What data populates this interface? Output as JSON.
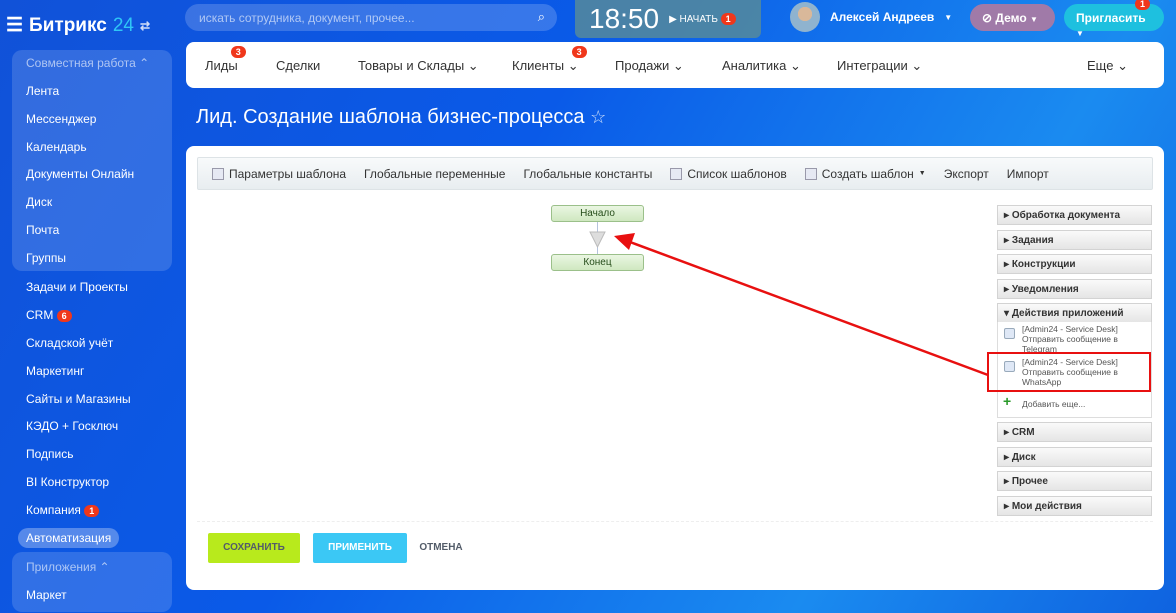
{
  "header": {
    "logo_text": "Битрикс",
    "logo_num": "24",
    "search_placeholder": "искать сотрудника, документ, прочее...",
    "time": "18:50",
    "start_label": "НАЧАТЬ",
    "start_badge": "1",
    "user_name": "Алексей Андреев",
    "demo_label": "Демо",
    "invite_label": "Пригласить",
    "invite_badge": "1"
  },
  "sidebar": {
    "group1_title": "Совместная работа",
    "group1_items": [
      "Лента",
      "Мессенджер",
      "Календарь",
      "Документы Онлайн",
      "Диск",
      "Почта",
      "Группы"
    ],
    "items": [
      {
        "label": "Задачи и Проекты"
      },
      {
        "label": "CRM",
        "badge": "6"
      },
      {
        "label": "Складской учёт"
      },
      {
        "label": "Маркетинг"
      },
      {
        "label": "Сайты и Магазины"
      },
      {
        "label": "КЭДО + Госключ"
      },
      {
        "label": "Подпись"
      },
      {
        "label": "BI Конструктор"
      },
      {
        "label": "Компания",
        "badge": "1"
      }
    ],
    "active": "Автоматизация",
    "group2_title": "Приложения",
    "group2_items": [
      "Маркет"
    ]
  },
  "nav": {
    "items": [
      {
        "label": "Лиды",
        "badge": "3"
      },
      {
        "label": "Сделки"
      },
      {
        "label": "Товары и Склады"
      },
      {
        "label": "Клиенты",
        "badge": "3"
      },
      {
        "label": "Продажи"
      },
      {
        "label": "Аналитика"
      },
      {
        "label": "Интеграции"
      },
      {
        "label": "Еще"
      }
    ]
  },
  "page": {
    "title": "Лид. Создание шаблона бизнес-процесса"
  },
  "toolbar": [
    "Параметры шаблона",
    "Глобальные переменные",
    "Глобальные константы",
    "Список шаблонов",
    "Создать шаблон",
    "Экспорт",
    "Импорт"
  ],
  "diagram": {
    "start": "Начало",
    "end": "Конец"
  },
  "palette": {
    "categories_top": [
      "Обработка документа",
      "Задания",
      "Конструкции",
      "Уведомления"
    ],
    "expanded": "Действия приложений",
    "apps": [
      {
        "line1": "[Admin24 - Service Desk]",
        "line2": "Отправить сообщение в",
        "line3": "Telegram"
      },
      {
        "line1": "[Admin24 - Service Desk]",
        "line2": "Отправить сообщение в",
        "line3": "WhatsApp"
      }
    ],
    "add_more": "Добавить еще...",
    "categories_bottom": [
      "CRM",
      "Диск",
      "Прочее",
      "Мои действия"
    ]
  },
  "footer": {
    "save": "СОХРАНИТЬ",
    "apply": "ПРИМЕНИТЬ",
    "cancel": "ОТМЕНА"
  },
  "colors": {
    "annotation": "#e81010",
    "save": "#b8ea1c",
    "apply": "#3bc8f5"
  }
}
